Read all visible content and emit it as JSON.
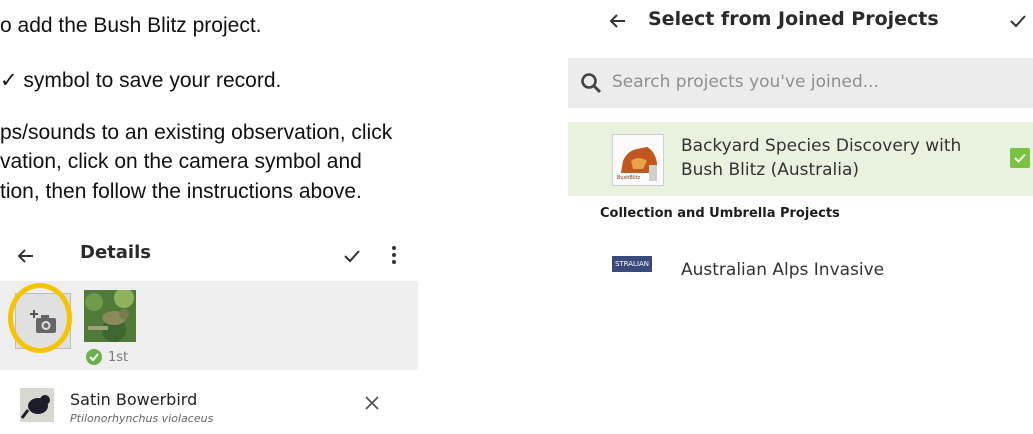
{
  "instructions": [
    "o add the Bush Blitz project.",
    "✓ symbol to save your record.",
    "ps/sounds to an existing observation, click",
    "vation, click on the camera symbol and",
    "tion, then follow the instructions above."
  ],
  "details_screen": {
    "title": "Details",
    "back_icon": "arrow-left-icon",
    "save_icon": "check-icon",
    "menu_icon": "more-vertical-icon",
    "add_photo_icon": "add-photo-camera-icon",
    "first_photo_label": "1st",
    "species": {
      "common_name": "Satin Bowerbird",
      "scientific_name": "Ptilonorhynchus violaceus"
    },
    "remove_icon": "close-icon",
    "highlight_color": "#f5c400",
    "badge_color": "#6ab04c"
  },
  "project_picker": {
    "title": "Select from Joined Projects",
    "back_icon": "arrow-left-icon",
    "save_icon": "check-icon",
    "search_placeholder": "Search projects you've joined...",
    "selected_project": {
      "name": "Backyard Species Discovery with Bush Blitz (Australia)",
      "logo_text": "BushBlitz",
      "checked": true
    },
    "section_header": "Collection and Umbrella Projects",
    "next_project": {
      "name": "Australian Alps Invasive",
      "logo_text": "STRALIAN A"
    },
    "selected_row_color": "#e9f2de",
    "checkbox_color": "#7cc242"
  }
}
